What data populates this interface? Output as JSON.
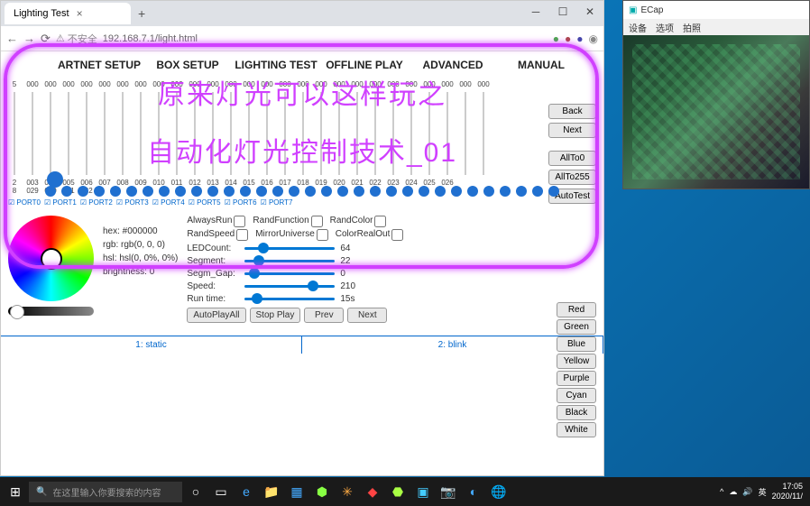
{
  "browser": {
    "tab_title": "Lighting Test",
    "warn": "不安全",
    "url": "192.168.7.1/light.html"
  },
  "nav": {
    "artnet": "ARTNET SETUP",
    "box": "BOX SETUP",
    "lighting": "LIGHTING TEST",
    "offline": "OFFLINE PLAY",
    "advanced": "ADVANCED",
    "manual": "MANUAL"
  },
  "slider_top": [
    "5",
    "000",
    "000",
    "000",
    "000",
    "000",
    "000",
    "000",
    "000",
    "000",
    "000",
    "000",
    "000",
    "000",
    "000",
    "000",
    "000",
    "000",
    "000",
    "000",
    "000",
    "000",
    "000",
    "000",
    "000",
    "000",
    "000"
  ],
  "slider_lbl1": [
    "2",
    "003",
    "004",
    "005",
    "006",
    "007",
    "008",
    "009",
    "010",
    "011",
    "012",
    "013",
    "014",
    "015",
    "016",
    "017",
    "018",
    "019",
    "020",
    "021",
    "022",
    "023",
    "024",
    "025",
    "026"
  ],
  "slider_lbl2": [
    "8",
    "029",
    "030",
    "031",
    "032"
  ],
  "side": {
    "back": "Back",
    "next": "Next",
    "allto0": "AllTo0",
    "allto255": "AllTo255",
    "autotest": "AutoTest"
  },
  "ports": [
    "PORT0",
    "PORT1",
    "PORT2",
    "PORT3",
    "PORT4",
    "PORT5",
    "PORT6",
    "PORT7"
  ],
  "color": {
    "hex": "hex: #000000",
    "rgb": "rgb: rgb(0, 0, 0)",
    "hsl": "hsl: hsl(0, 0%, 0%)",
    "brightness": "brightness: 0"
  },
  "chk": {
    "always": "AlwaysRun",
    "randf": "RandFunction",
    "randc": "RandColor",
    "rands": "RandSpeed",
    "mirror": "MirrorUniverse",
    "colorout": "ColorRealOut"
  },
  "params": {
    "ledcount": {
      "lbl": "LEDCount:",
      "val": "64",
      "pct": 15
    },
    "segment": {
      "lbl": "Segment:",
      "val": "22",
      "pct": 10
    },
    "gap": {
      "lbl": "Segm_Gap:",
      "val": "0",
      "pct": 5
    },
    "speed": {
      "lbl": "Speed:",
      "val": "210",
      "pct": 70
    },
    "runtime": {
      "lbl": "Run time:",
      "val": "15s",
      "pct": 8
    }
  },
  "pbtns": {
    "auto": "AutoPlayAll",
    "stop": "Stop Play",
    "prev": "Prev",
    "next": "Next"
  },
  "colorbtns": [
    "Red",
    "Green",
    "Blue",
    "Yellow",
    "Purple",
    "Cyan",
    "Black",
    "White"
  ],
  "modes": {
    "m1": "1: static",
    "m2": "2: blink"
  },
  "overlay": {
    "t1": "原来灯光可以这样玩之",
    "t2": "自动化灯光控制技术_01"
  },
  "ecap": {
    "title": "ECap",
    "menu": [
      "设备",
      "选项",
      "拍照"
    ]
  },
  "taskbar": {
    "search": "在这里输入你要搜索的内容",
    "time": "17:05",
    "date": "2020/11/",
    "ime": "英"
  }
}
